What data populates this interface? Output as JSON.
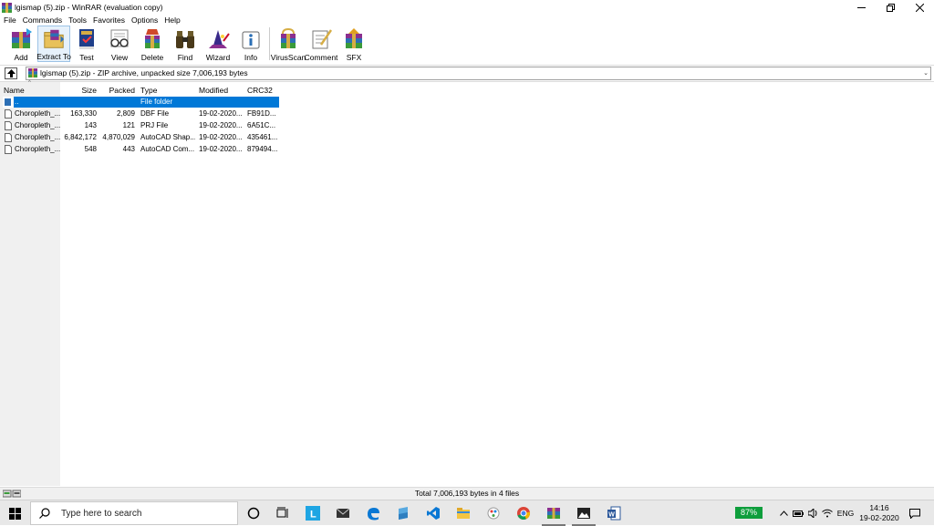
{
  "window": {
    "title": "lgismap (5).zip - WinRAR (evaluation copy)",
    "controls": [
      "minimize-icon",
      "maximize-icon",
      "close-icon"
    ]
  },
  "menu": [
    "File",
    "Commands",
    "Tools",
    "Favorites",
    "Options",
    "Help"
  ],
  "toolbar": [
    {
      "label": "Add",
      "icon": "add-archive-icon"
    },
    {
      "label": "Extract To",
      "icon": "extract-folder-icon"
    },
    {
      "label": "Test",
      "icon": "test-book-icon"
    },
    {
      "label": "View",
      "icon": "view-glasses-icon"
    },
    {
      "label": "Delete",
      "icon": "delete-icon"
    },
    {
      "label": "Find",
      "icon": "binoculars-icon"
    },
    {
      "label": "Wizard",
      "icon": "wizard-icon"
    },
    {
      "label": "Info",
      "icon": "info-icon"
    },
    {
      "label": "VirusScan",
      "icon": "virus-scan-icon"
    },
    {
      "label": "Comment",
      "icon": "comment-icon"
    },
    {
      "label": "SFX",
      "icon": "sfx-icon"
    }
  ],
  "address": {
    "text": "lgismap (5).zip - ZIP archive, unpacked size 7,006,193 bytes"
  },
  "columns": [
    "Name",
    "Size",
    "Packed",
    "Type",
    "Modified",
    "CRC32"
  ],
  "rows": [
    {
      "name": "..",
      "size": "",
      "packed": "",
      "type": "File folder",
      "modified": "",
      "crc": "",
      "selected": true
    },
    {
      "name": "Choropleth_...",
      "size": "163,330",
      "packed": "2,809",
      "type": "DBF File",
      "modified": "19-02-2020...",
      "crc": "FB91D..."
    },
    {
      "name": "Choropleth_...",
      "size": "143",
      "packed": "121",
      "type": "PRJ File",
      "modified": "19-02-2020...",
      "crc": "6A51C..."
    },
    {
      "name": "Choropleth_...",
      "size": "6,842,172",
      "packed": "4,870,029",
      "type": "AutoCAD Shap...",
      "modified": "19-02-2020...",
      "crc": "435461..."
    },
    {
      "name": "Choropleth_...",
      "size": "548",
      "packed": "443",
      "type": "AutoCAD Com...",
      "modified": "19-02-2020...",
      "crc": "879494..."
    }
  ],
  "status": {
    "text": "Total 7,006,193 bytes in 4 files"
  },
  "taskbar": {
    "search_placeholder": "Type here to search",
    "battery": "87%",
    "language": "ENG",
    "time": "14:16",
    "date": "19-02-2020"
  }
}
